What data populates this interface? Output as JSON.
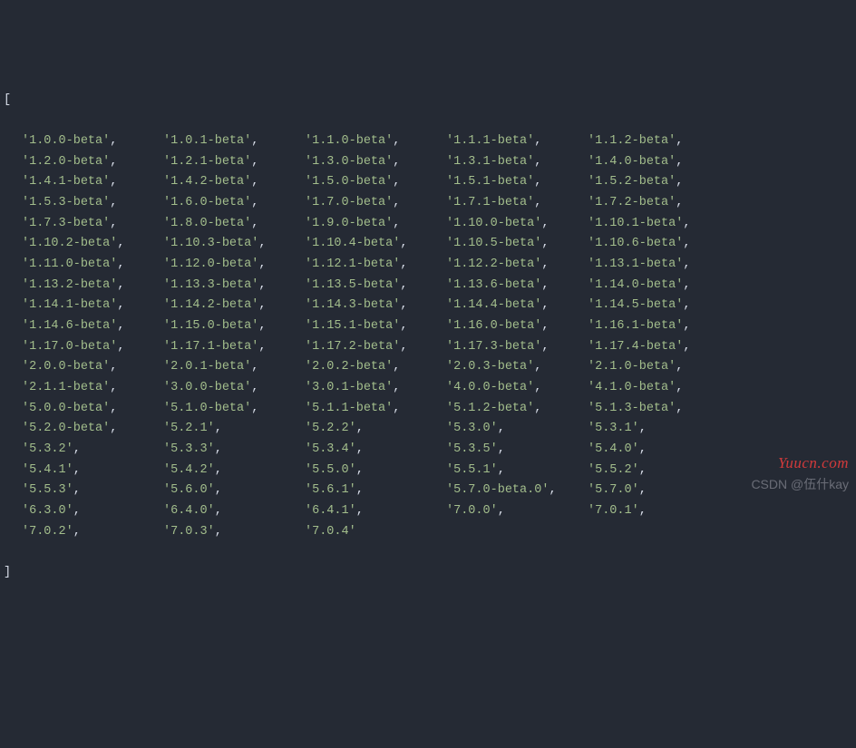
{
  "brackets": {
    "open": "[",
    "close": "]"
  },
  "rows": [
    [
      "1.0.0-beta",
      "1.0.1-beta",
      "1.1.0-beta",
      "1.1.1-beta",
      "1.1.2-beta"
    ],
    [
      "1.2.0-beta",
      "1.2.1-beta",
      "1.3.0-beta",
      "1.3.1-beta",
      "1.4.0-beta"
    ],
    [
      "1.4.1-beta",
      "1.4.2-beta",
      "1.5.0-beta",
      "1.5.1-beta",
      "1.5.2-beta"
    ],
    [
      "1.5.3-beta",
      "1.6.0-beta",
      "1.7.0-beta",
      "1.7.1-beta",
      "1.7.2-beta"
    ],
    [
      "1.7.3-beta",
      "1.8.0-beta",
      "1.9.0-beta",
      "1.10.0-beta",
      "1.10.1-beta"
    ],
    [
      "1.10.2-beta",
      "1.10.3-beta",
      "1.10.4-beta",
      "1.10.5-beta",
      "1.10.6-beta"
    ],
    [
      "1.11.0-beta",
      "1.12.0-beta",
      "1.12.1-beta",
      "1.12.2-beta",
      "1.13.1-beta"
    ],
    [
      "1.13.2-beta",
      "1.13.3-beta",
      "1.13.5-beta",
      "1.13.6-beta",
      "1.14.0-beta"
    ],
    [
      "1.14.1-beta",
      "1.14.2-beta",
      "1.14.3-beta",
      "1.14.4-beta",
      "1.14.5-beta"
    ],
    [
      "1.14.6-beta",
      "1.15.0-beta",
      "1.15.1-beta",
      "1.16.0-beta",
      "1.16.1-beta"
    ],
    [
      "1.17.0-beta",
      "1.17.1-beta",
      "1.17.2-beta",
      "1.17.3-beta",
      "1.17.4-beta"
    ],
    [
      "2.0.0-beta",
      "2.0.1-beta",
      "2.0.2-beta",
      "2.0.3-beta",
      "2.1.0-beta"
    ],
    [
      "2.1.1-beta",
      "3.0.0-beta",
      "3.0.1-beta",
      "4.0.0-beta",
      "4.1.0-beta"
    ],
    [
      "5.0.0-beta",
      "5.1.0-beta",
      "5.1.1-beta",
      "5.1.2-beta",
      "5.1.3-beta"
    ],
    [
      "5.2.0-beta",
      "5.2.1",
      "5.2.2",
      "5.3.0",
      "5.3.1"
    ],
    [
      "5.3.2",
      "5.3.3",
      "5.3.4",
      "5.3.5",
      "5.4.0"
    ],
    [
      "5.4.1",
      "5.4.2",
      "5.5.0",
      "5.5.1",
      "5.5.2"
    ],
    [
      "5.5.3",
      "5.6.0",
      "5.6.1",
      "5.7.0-beta.0",
      "5.7.0"
    ],
    [
      "6.3.0",
      "6.4.0",
      "6.4.1",
      "7.0.0",
      "7.0.1"
    ],
    [
      "7.0.2",
      "7.0.3",
      "7.0.4"
    ]
  ],
  "watermarks": {
    "site": "Yuucn.com",
    "csdn": "CSDN @伍什kay"
  }
}
